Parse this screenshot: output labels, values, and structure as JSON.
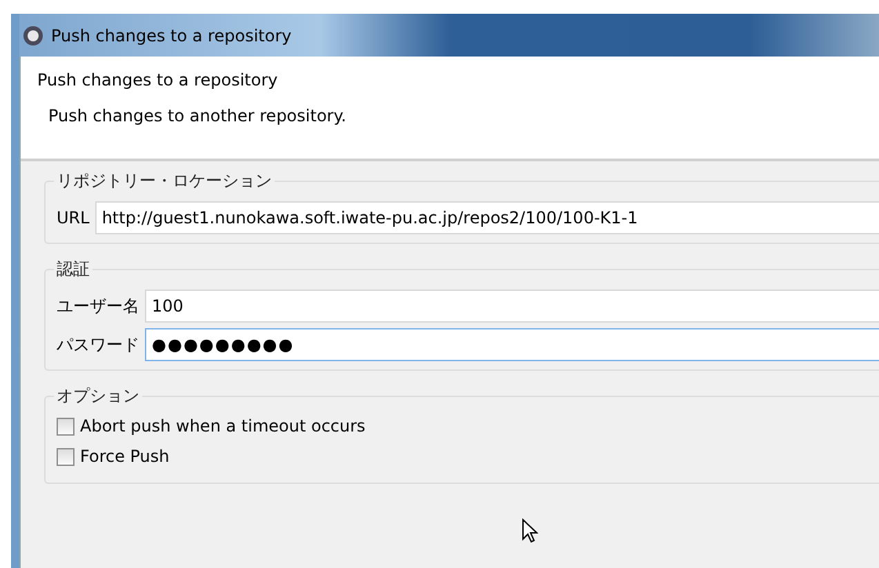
{
  "window": {
    "title": "Push changes to a repository"
  },
  "header": {
    "title": "Push changes to a repository",
    "description": "Push changes to another repository."
  },
  "groups": [
    {
      "title": "リポジトリー・ロケーション",
      "fields": [
        {
          "label": "URL",
          "value": "http://guest1.nunokawa.soft.iwate-pu.ac.jp/repos2/100/100-K1-1",
          "focused": false
        }
      ]
    },
    {
      "title": "認証",
      "fields": [
        {
          "label": "ユーザー名",
          "value": "100",
          "focused": false
        },
        {
          "label": "パスワード",
          "value": "●●●●●●●●●",
          "focused": true
        }
      ]
    }
  ],
  "options": {
    "title": "オプション",
    "items": [
      {
        "label": "Abort push when a timeout occurs",
        "checked": false
      },
      {
        "label": "Force Push",
        "checked": false
      }
    ]
  }
}
